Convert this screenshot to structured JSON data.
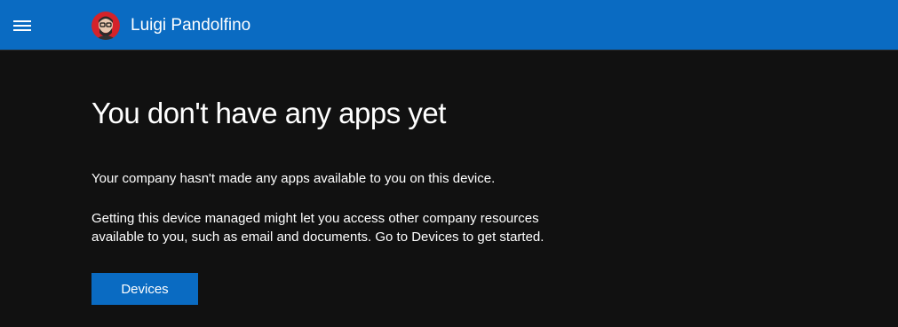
{
  "header": {
    "menu_icon": "hamburger-menu-icon",
    "user_name": "Luigi Pandolfino",
    "avatar_icon": "user-avatar",
    "brand_color": "#0a6bc2"
  },
  "main": {
    "title": "You don't have any apps yet",
    "message": "Your company hasn't made any apps available to you on this device.",
    "description": "Getting this device managed might let you access other company resources available to you, such as email and documents. Go to Devices to get started.",
    "devices_button_label": "Devices"
  }
}
